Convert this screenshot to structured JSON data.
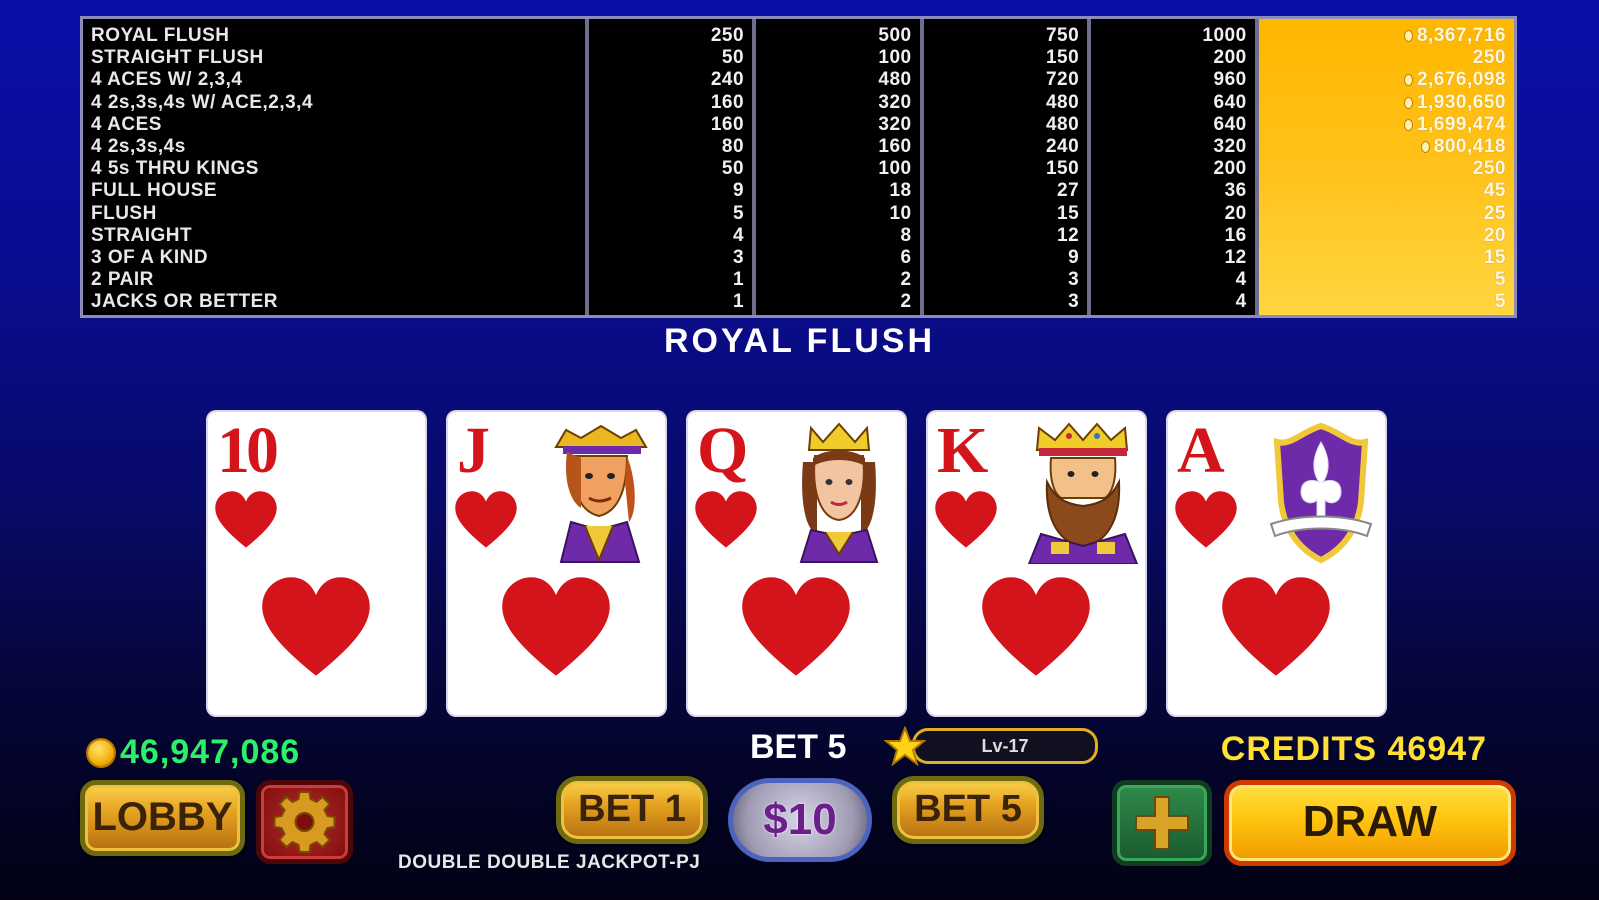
{
  "paytable": {
    "hands": [
      "ROYAL FLUSH",
      "STRAIGHT FLUSH",
      "4 ACES W/ 2,3,4",
      "4 2s,3s,4s W/ ACE,2,3,4",
      "4 ACES",
      "4 2s,3s,4s",
      "4 5s THRU KINGS",
      "FULL HOUSE",
      "FLUSH",
      "STRAIGHT",
      "3 OF A KIND",
      "2 PAIR",
      "JACKS OR BETTER"
    ],
    "bet1": [
      "250",
      "50",
      "240",
      "160",
      "160",
      "80",
      "50",
      "9",
      "5",
      "4",
      "3",
      "1",
      "1"
    ],
    "bet2": [
      "500",
      "100",
      "480",
      "320",
      "320",
      "160",
      "100",
      "18",
      "10",
      "8",
      "6",
      "2",
      "2"
    ],
    "bet3": [
      "750",
      "150",
      "720",
      "480",
      "480",
      "240",
      "150",
      "27",
      "15",
      "12",
      "9",
      "3",
      "3"
    ],
    "bet4": [
      "1000",
      "200",
      "960",
      "640",
      "640",
      "320",
      "200",
      "36",
      "20",
      "16",
      "12",
      "4",
      "4"
    ],
    "bet5": [
      "8,367,716",
      "250",
      "2,676,098",
      "1,930,650",
      "1,699,474",
      "800,418",
      "250",
      "45",
      "25",
      "20",
      "15",
      "5",
      "5"
    ],
    "bet5_jackpot_rows": [
      0,
      2,
      3,
      4,
      5
    ],
    "highlight_color": "#ffb700"
  },
  "win_banner": "ROYAL FLUSH",
  "cards": [
    {
      "rank": "10",
      "suit": "heart",
      "face": "none"
    },
    {
      "rank": "J",
      "suit": "heart",
      "face": "jack"
    },
    {
      "rank": "Q",
      "suit": "heart",
      "face": "queen"
    },
    {
      "rank": "K",
      "suit": "heart",
      "face": "king"
    },
    {
      "rank": "A",
      "suit": "heart",
      "face": "ace-shield"
    }
  ],
  "balance": "46,947,086",
  "bet_display": "BET 5",
  "level": "Lv-17",
  "credits": "CREDITS 46947",
  "buttons": {
    "lobby": "LOBBY",
    "bet1": "BET 1",
    "denomination": "$10",
    "bet5": "BET 5",
    "draw": "DRAW"
  },
  "game_name": "DOUBLE DOUBLE JACKPOT-PJ",
  "colors": {
    "suit_red": "#d3151b",
    "balance_green": "#2cf06a",
    "credits_yellow": "#ffe033"
  }
}
